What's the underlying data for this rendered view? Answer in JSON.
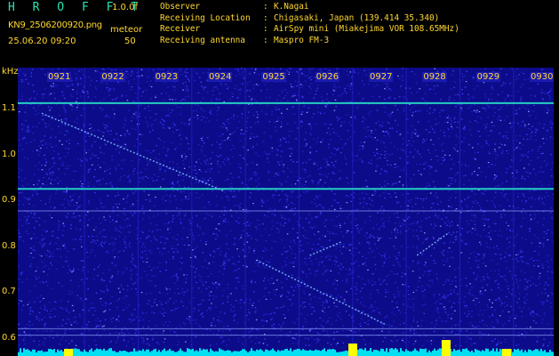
{
  "header": {
    "brand": "H R O F F T",
    "version": "1.0.0f",
    "filename": "KN9_2506200920.png",
    "mode": "meteor",
    "datetime": "25.06.20 09:20",
    "count": "50"
  },
  "station_info": [
    {
      "key": "Observer",
      "value": "K.Nagai"
    },
    {
      "key": "Receiving Location",
      "value": "Chigasaki, Japan (139.414 35.340)"
    },
    {
      "key": "Receiver",
      "value": "AirSpy mini (Miakejima VOR 108.65MHz)"
    },
    {
      "key": "Receiving antenna",
      "value": "Maspro FM-3"
    }
  ],
  "spectrogram": {
    "y_unit": "kHz",
    "y_ticks": [
      "1.1",
      "1.0",
      "0.9",
      "0.8",
      "0.7",
      "0.6"
    ],
    "y_range": [
      0.58,
      1.17
    ],
    "time_ticks": [
      "0921",
      "0922",
      "0923",
      "0924",
      "0925",
      "0926",
      "0927",
      "0928",
      "0929",
      "0930"
    ],
    "background_color": "#0c0c8a",
    "noise_color": "#3c3cff",
    "signal_color": "#27e3c8",
    "meter_color": "#00e0f0",
    "burst_color": "#ffff00",
    "carrier_lines_khz": [
      1.112,
      0.925,
      0.877,
      0.62,
      0.606
    ],
    "meteor_traces": [
      {
        "from": [
          "0921",
          1.09
        ],
        "to": [
          "0924",
          0.92
        ]
      },
      {
        "from": [
          "0925",
          0.77
        ],
        "to": [
          "0927",
          0.63
        ]
      },
      {
        "from": [
          "0926",
          0.78
        ],
        "to": [
          "0926",
          0.81
        ]
      },
      {
        "from": [
          "0928",
          0.78
        ],
        "to": [
          "0928",
          0.83
        ]
      }
    ]
  }
}
